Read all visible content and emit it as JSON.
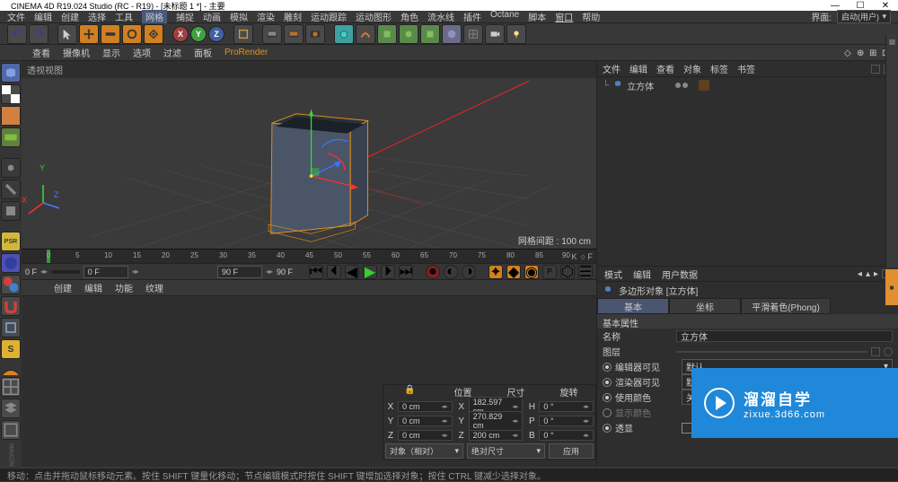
{
  "titlebar": {
    "title": "CINEMA 4D R19.024 Studio (RC - R19) - [未标题 1 *] - 主要"
  },
  "menubar": {
    "items": [
      "文件",
      "编辑",
      "创建",
      "选择",
      "工具",
      "网格",
      "捕捉",
      "动画",
      "模拟",
      "渲染",
      "雕刻",
      "运动跟踪",
      "运动图形",
      "角色",
      "流水线",
      "插件",
      "Octane",
      "脚本",
      "窗口",
      "帮助"
    ],
    "right_label": "界面:",
    "right_value": "启动(用户)"
  },
  "toolbar": {
    "undo": "↶",
    "redo": "↷",
    "x": "X",
    "y": "Y",
    "z": "Z"
  },
  "submenu": {
    "items": [
      "查看",
      "摄像机",
      "显示",
      "选项",
      "过滤",
      "面板",
      "ProRender"
    ]
  },
  "viewport": {
    "label": "透视视图",
    "grid_info": "网格间距 : 100 cm",
    "axis": {
      "x": "X",
      "y": "Y",
      "z": "Z"
    }
  },
  "timeline": {
    "ticks": [
      "0",
      "5",
      "10",
      "15",
      "20",
      "25",
      "30",
      "35",
      "40",
      "45",
      "50",
      "55",
      "60",
      "65",
      "70",
      "75",
      "80",
      "85",
      "90"
    ]
  },
  "playback": {
    "start_lbl": "0 F",
    "start_val": "0 F",
    "end_val": "90 F",
    "end_lbl": "90 F"
  },
  "bottom_tabs": {
    "items": [
      "创建",
      "编辑",
      "功能",
      "纹理"
    ]
  },
  "coord": {
    "headers": [
      "位置",
      "尺寸",
      "旋转"
    ],
    "rows": [
      {
        "axis": "X",
        "pos": "0 cm",
        "size": "182.597 cm",
        "rot_lbl": "H",
        "rot": "0 °"
      },
      {
        "axis": "Y",
        "pos": "0 cm",
        "size": "270.829 cm",
        "rot_lbl": "P",
        "rot": "0 °"
      },
      {
        "axis": "Z",
        "pos": "0 cm",
        "size": "200 cm",
        "rot_lbl": "B",
        "rot": "0 °"
      }
    ],
    "dd1": "对象（相对）",
    "dd2": "绝对尺寸",
    "apply": "应用"
  },
  "obj_panel": {
    "hdr_tabs": [
      "文件",
      "编辑",
      "查看",
      "对象",
      "标签",
      "书签"
    ],
    "item_label": "立方体"
  },
  "attr_panel": {
    "menubar": [
      "模式",
      "编辑",
      "用户数据"
    ],
    "header": "多边形对象 [立方体]",
    "tabs": [
      "基本",
      "坐标",
      "平滑着色(Phong)"
    ],
    "section": "基本属性",
    "rows": {
      "name_lbl": "名称",
      "name_val": "立方体",
      "layer_lbl": "图层",
      "editor_vis_lbl": "编辑器可见",
      "editor_vis_val": "默认",
      "render_vis_lbl": "渲染器可见",
      "render_vis_val": "默认",
      "use_color_lbl": "使用颜色",
      "use_color_val": "关闭",
      "disp_color_lbl": "显示颜色",
      "through_lbl": "透显"
    }
  },
  "watermark": {
    "cn": "溜溜自学",
    "url": "zixue.3d66.com"
  },
  "statusbar": {
    "text": "移动：点击并拖动鼠标移动元素。按住 SHIFT 键量化移动；节点编辑模式时按住 SHIFT 键增加选择对象；按住 CTRL 键减少选择对象。"
  },
  "left_strip": {
    "psr": "PSR",
    "s_btn": "S",
    "maxon": "MAXON"
  }
}
